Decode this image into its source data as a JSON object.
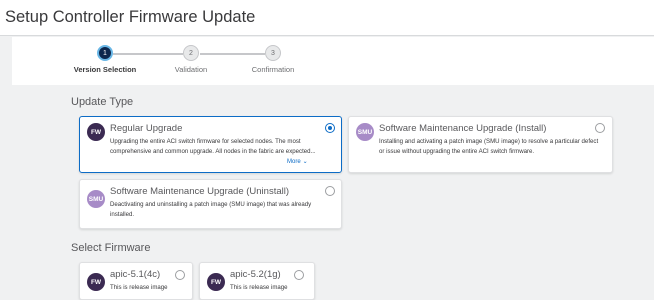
{
  "page": {
    "title": "Setup Controller Firmware Update"
  },
  "wizard": {
    "steps": [
      {
        "number": "1",
        "label": "Version Selection",
        "state": "active"
      },
      {
        "number": "2",
        "label": "Validation",
        "state": "inactive"
      },
      {
        "number": "3",
        "label": "Confirmation",
        "state": "inactive"
      }
    ]
  },
  "update_type": {
    "heading": "Update Type",
    "options": [
      {
        "badge": "FW",
        "title": "Regular Upgrade",
        "description": "Upgrading the entire ACI switch firmware for selected nodes. The most comprehensive and common upgrade. All nodes in the fabric are expected...",
        "more_label": "More",
        "selected": true
      },
      {
        "badge": "SMU",
        "title": "Software Maintenance Upgrade (Install)",
        "description": "Installing and activating a patch image (SMU image) to resolve a particular defect or issue without upgrading the entire ACI switch firmware.",
        "selected": false
      },
      {
        "badge": "SMU",
        "title": "Software Maintenance Upgrade (Uninstall)",
        "description": "Deactivating and uninstalling a patch image (SMU image) that was already installed.",
        "selected": false
      }
    ]
  },
  "select_firmware": {
    "heading": "Select Firmware",
    "images": [
      {
        "badge": "FW",
        "name": "apic-5.1(4c)",
        "description": "This is release image",
        "selected": false
      },
      {
        "badge": "FW",
        "name": "apic-5.2(1g)",
        "description": "This is release image",
        "selected": false
      }
    ]
  },
  "colors": {
    "accent": "#0d6cc6",
    "fw_badge": "#3b2a52",
    "smu_badge": "#a78bc7"
  },
  "icons": {
    "more": "chevron-down-icon"
  }
}
